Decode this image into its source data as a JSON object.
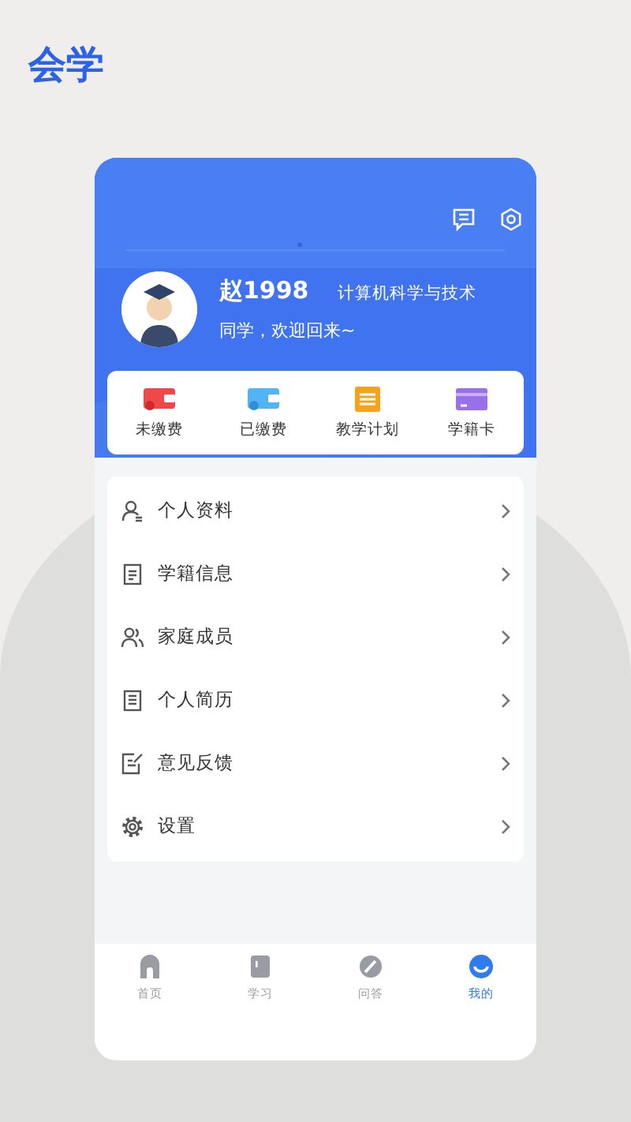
{
  "logo": "会学",
  "header": {
    "name": "赵1998",
    "major": "计算机科学与技术",
    "greeting": "同学，欢迎回来~"
  },
  "quick_actions": [
    {
      "label": "未缴费",
      "kind": "unpaid"
    },
    {
      "label": "已缴费",
      "kind": "paid"
    },
    {
      "label": "教学计划",
      "kind": "plan"
    },
    {
      "label": "学籍卡",
      "kind": "card"
    }
  ],
  "menu": [
    {
      "label": "个人资料",
      "kind": "profile"
    },
    {
      "label": "学籍信息",
      "kind": "record"
    },
    {
      "label": "家庭成员",
      "kind": "family"
    },
    {
      "label": "个人简历",
      "kind": "resume"
    },
    {
      "label": "意见反馈",
      "kind": "feedback"
    },
    {
      "label": "设置",
      "kind": "settings"
    }
  ],
  "tabs": [
    {
      "label": "首页",
      "kind": "home",
      "selected": false
    },
    {
      "label": "学习",
      "kind": "study",
      "selected": false
    },
    {
      "label": "问答",
      "kind": "qa",
      "selected": false
    },
    {
      "label": "我的",
      "kind": "mine",
      "selected": true
    }
  ]
}
